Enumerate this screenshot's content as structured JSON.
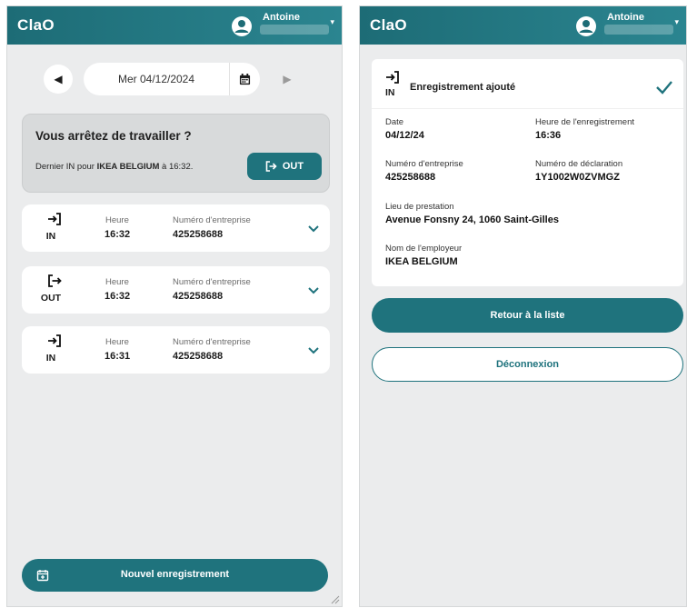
{
  "app": {
    "title": "ClaO"
  },
  "user": {
    "name": "Antoine",
    "caret": "▾"
  },
  "left": {
    "date_nav": {
      "prev": "◀",
      "date": "Mer 04/12/2024",
      "next": "▶"
    },
    "stop_card": {
      "title": "Vous arrêtez de travailler ?",
      "text_prefix": "Dernier IN pour ",
      "company": "IKEA BELGIUM",
      "text_suffix": " à 16:32.",
      "button_label": "OUT",
      "button_icon": "sign-out-icon"
    },
    "entries": [
      {
        "icon": "sign-in-icon",
        "glyph": "➜]",
        "type": "IN",
        "hour_label": "Heure",
        "hour": "16:32",
        "number_label": "Numéro d'entreprise",
        "number": "425258688"
      },
      {
        "icon": "sign-out-icon",
        "glyph": "[➜",
        "type": "OUT",
        "hour_label": "Heure",
        "hour": "16:32",
        "number_label": "Numéro d'entreprise",
        "number": "425258688"
      },
      {
        "icon": "sign-in-icon",
        "glyph": "➜]",
        "type": "IN",
        "hour_label": "Heure",
        "hour": "16:31",
        "number_label": "Numéro d'entreprise",
        "number": "425258688"
      }
    ],
    "new_button": "Nouvel enregistrement"
  },
  "right": {
    "detail": {
      "type": "IN",
      "glyph": "➜]",
      "title": "Enregistrement ajouté",
      "date_label": "Date",
      "date": "04/12/24",
      "time_label": "Heure de l'enregistrement",
      "time": "16:36",
      "company_label": "Numéro d'entreprise",
      "company": "425258688",
      "declaration_label": "Numéro de déclaration",
      "declaration": "1Y1002W0ZVMGZ",
      "place_label": "Lieu de prestation",
      "place": "Avenue Fonsny 24, 1060 Saint-Gilles",
      "employer_label": "Nom de l'employeur",
      "employer": "IKEA BELGIUM"
    },
    "back_button": "Retour à la liste",
    "logout_button": "Déconnexion"
  },
  "colors": {
    "primary": "#1f737d",
    "header": "#1d6c76",
    "background": "#ebeced",
    "card": "#ffffff"
  }
}
